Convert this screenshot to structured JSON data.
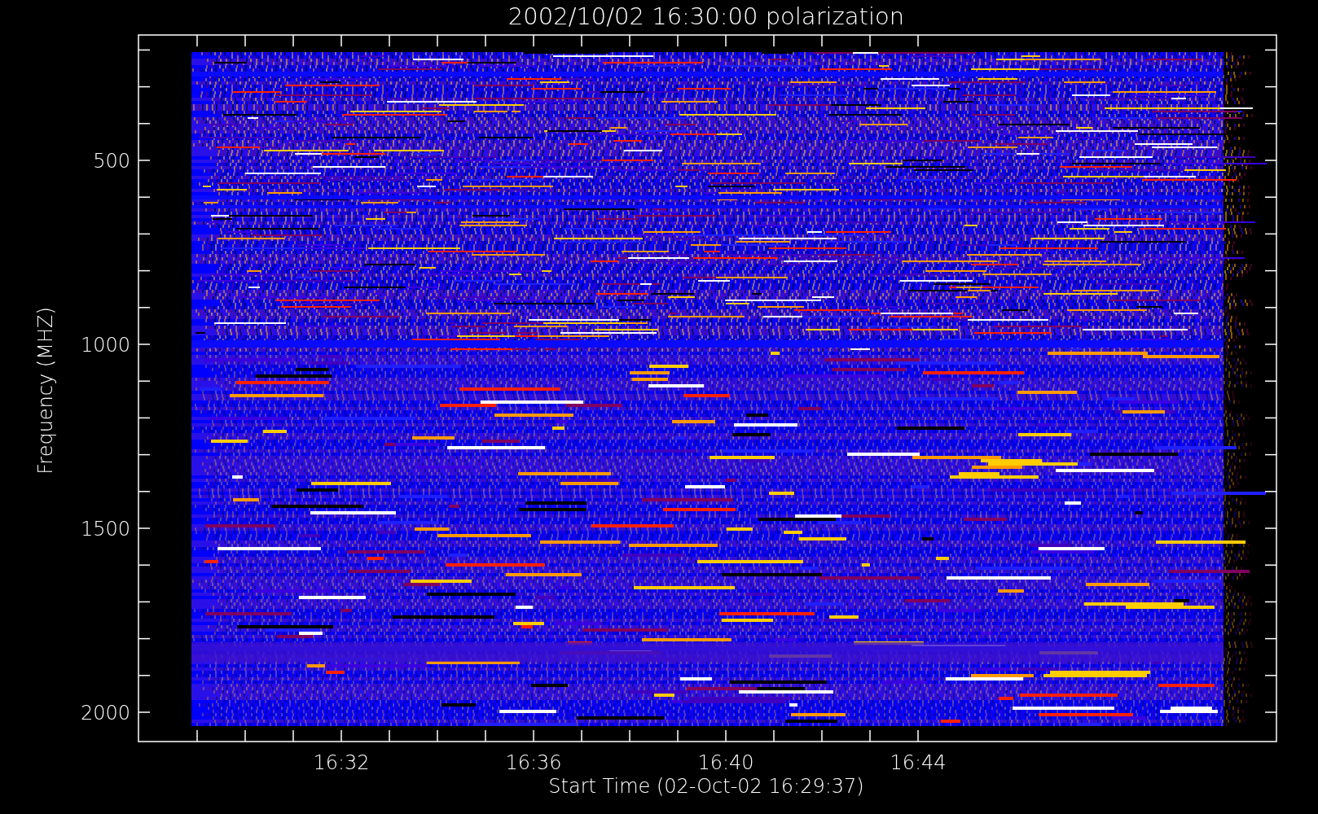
{
  "title": "2002/10/02 16:30:00 polarization",
  "y_axis": {
    "label": "Frequency (MHZ)",
    "ticks": [
      "500",
      "1000",
      "1500",
      "2000"
    ]
  },
  "x_axis": {
    "label": "Start Time (02-Oct-02 16:29:37)",
    "ticks": [
      "16:32",
      "16:36",
      "16:40",
      "16:44"
    ]
  }
}
